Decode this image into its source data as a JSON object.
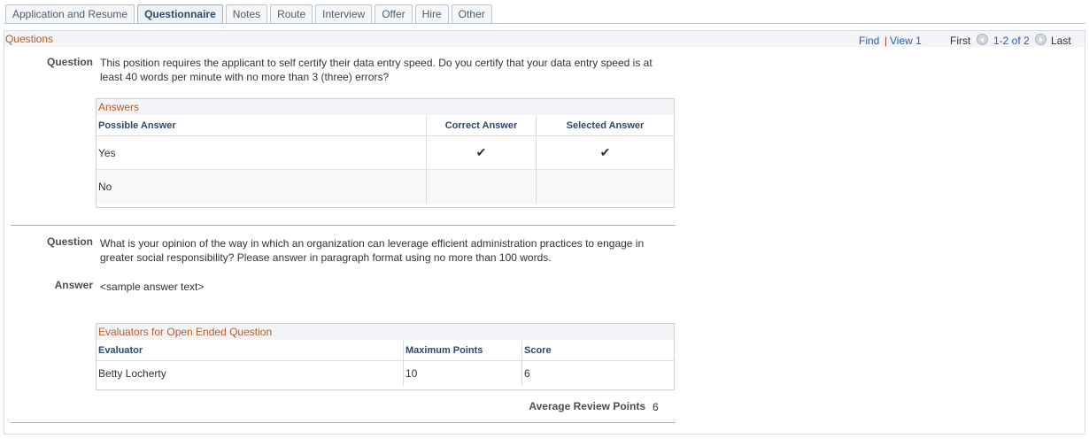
{
  "tabs": [
    {
      "label": "Application and Resume",
      "active": false
    },
    {
      "label": "Questionnaire",
      "active": true
    },
    {
      "label": "Notes",
      "active": false
    },
    {
      "label": "Route",
      "active": false
    },
    {
      "label": "Interview",
      "active": false
    },
    {
      "label": "Offer",
      "active": false
    },
    {
      "label": "Hire",
      "active": false
    },
    {
      "label": "Other",
      "active": false
    }
  ],
  "questions_grid": {
    "title": "Questions",
    "find": "Find",
    "sep": "|",
    "view": "View 1",
    "first": "First",
    "range": "1-2 of 2",
    "last": "Last"
  },
  "q1": {
    "label": "Question",
    "text_line1": "This position requires the applicant to self certify their data entry speed.  Do you certify that your data entry speed is at",
    "text_line2": "least 40 words per minute with no more than 3 (three) errors?",
    "answers": {
      "title": "Answers",
      "columns": [
        "Possible Answer",
        "Correct Answer",
        "Selected Answer"
      ],
      "rows": [
        {
          "answer": "Yes",
          "correct": true,
          "selected": true
        },
        {
          "answer": "No",
          "correct": false,
          "selected": false
        }
      ]
    }
  },
  "q2": {
    "label": "Question",
    "text_line1": "What is your opinion of the way in which an organization can leverage efficient administration practices to engage in",
    "text_line2": "greater social responsibility?  Please answer in paragraph format using no more than 100 words.",
    "answer_label": "Answer",
    "answer_text": "<sample answer text>",
    "evaluators": {
      "title": "Evaluators for Open Ended Question",
      "columns": [
        "Evaluator",
        "Maximum Points",
        "Score"
      ],
      "rows": [
        {
          "evaluator": "Betty Locherty",
          "max": "10",
          "score": "6"
        }
      ]
    },
    "average_label": "Average Review Points",
    "average_value": "6"
  },
  "icons": {
    "check": "checkmark-icon",
    "prev": "previous-arrow-icon",
    "next": "next-arrow-icon"
  }
}
